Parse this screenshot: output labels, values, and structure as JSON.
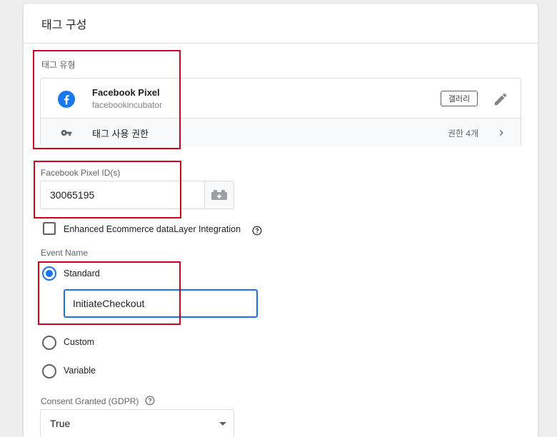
{
  "panel": {
    "title": "태그 구성"
  },
  "tag_type": {
    "section_label": "태그 유형",
    "name": "Facebook Pixel",
    "vendor": "facebookincubator",
    "gallery_label": "갤러리",
    "permissions_label": "태그 사용 권한",
    "permissions_count": "권한 4개",
    "brand_color": "#1877f2"
  },
  "pixel": {
    "label": "Facebook Pixel ID(s)",
    "value": "30065195"
  },
  "enhanced_ecommerce": {
    "label": "Enhanced Ecommerce dataLayer Integration",
    "checked": false
  },
  "event_name": {
    "label": "Event Name",
    "options": [
      {
        "label": "Standard",
        "selected": true
      },
      {
        "label": "Custom",
        "selected": false
      },
      {
        "label": "Variable",
        "selected": false
      }
    ],
    "standard_value": "InitiateCheckout"
  },
  "consent": {
    "label": "Consent Granted (GDPR)",
    "value": "True"
  },
  "colors": {
    "accent": "#1a73e8",
    "highlight": "#d0021b"
  },
  "icons": [
    "facebook-logo-icon",
    "pencil-icon",
    "key-icon",
    "chevron-right-icon",
    "variable-icon",
    "help-icon",
    "dropdown-caret-icon"
  ]
}
